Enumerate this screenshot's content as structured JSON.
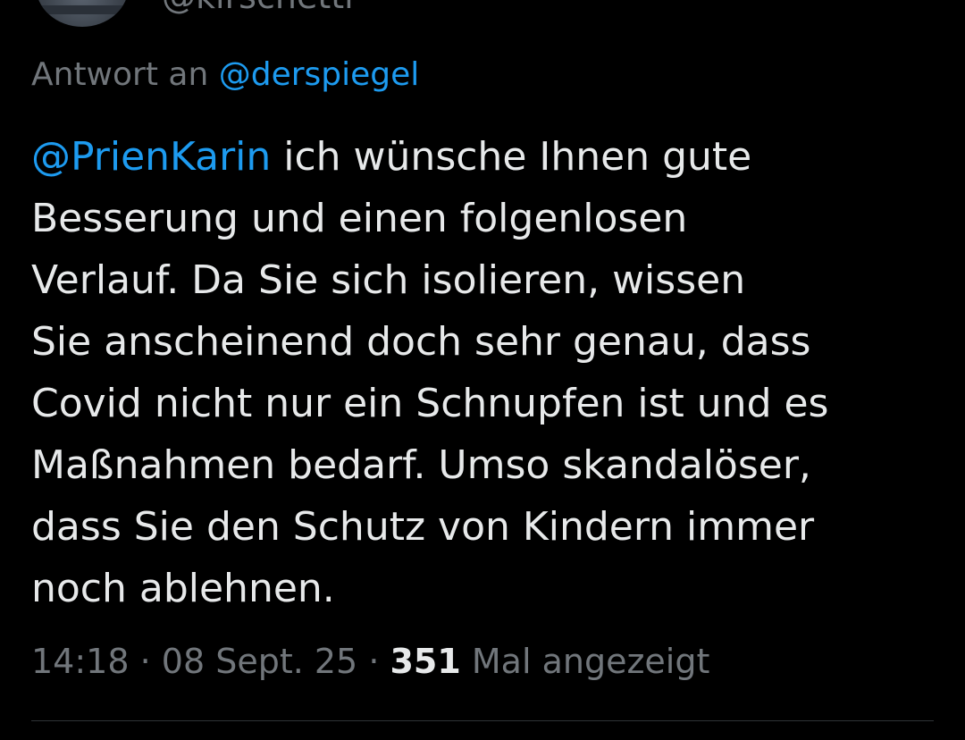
{
  "author": {
    "handle": "@kirschetti"
  },
  "reply_context": {
    "prefix": "Antwort an",
    "mention": "@derspiegel"
  },
  "tweet": {
    "mention": "@PrienKarin",
    "lines": [
      " ich wünsche Ihnen gute",
      "Besserung und einen folgenlosen",
      "Verlauf. Da Sie sich isolieren, wissen",
      "Sie anscheinend doch sehr genau, dass",
      "Covid nicht nur ein Schnupfen ist und es",
      "Maßnahmen bedarf. Umso skandalöser,",
      "dass Sie den Schutz von Kindern immer",
      "noch ablehnen."
    ]
  },
  "meta": {
    "time": "14:18",
    "separator": " · ",
    "date": "08 Sept. 25",
    "views_count": "351",
    "views_label": " Mal angezeigt"
  },
  "colors": {
    "background": "#000000",
    "text": "#e7e9ea",
    "secondary": "#71767b",
    "link": "#1d9bf0",
    "divider": "#2f3336"
  }
}
